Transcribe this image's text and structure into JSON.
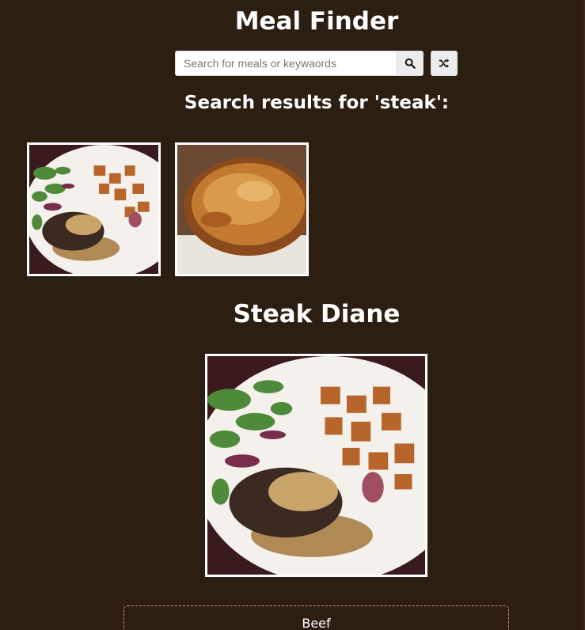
{
  "app": {
    "title": "Meal Finder"
  },
  "search": {
    "placeholder": "Search for meals or keywaords",
    "value": ""
  },
  "icons": {
    "search": "search-icon",
    "random": "shuffle-icon"
  },
  "results": {
    "heading": "Search results for 'steak':",
    "items": [
      {
        "name": "steak-diane-thumbnail",
        "image": "steak-with-salad-and-potatoes"
      },
      {
        "name": "steak-pie-thumbnail",
        "image": "golden-pastry-pie"
      }
    ]
  },
  "meal": {
    "title": "Steak Diane",
    "image": "steak-with-peppercorn-sauce-salad-and-potatoes",
    "category": "Beef"
  },
  "colors": {
    "background": "#2d1e12",
    "text": "#ffffff",
    "category_border": "#c9a26b"
  }
}
